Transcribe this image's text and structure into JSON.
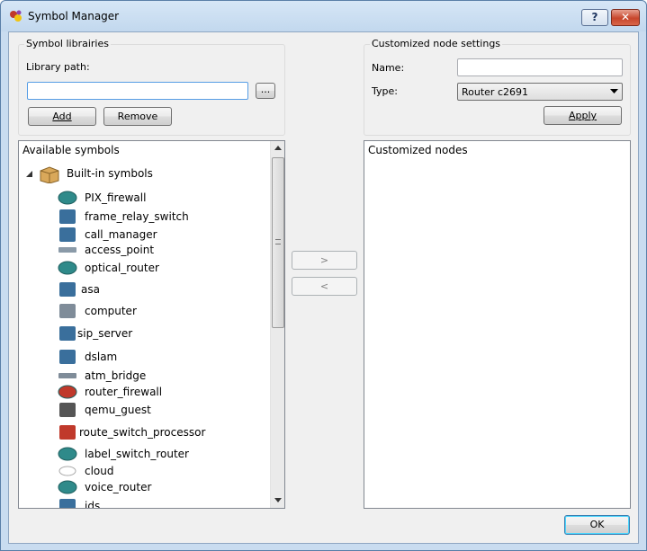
{
  "window": {
    "title": "Symbol Manager",
    "help_label": "?",
    "close_label": "✕"
  },
  "library": {
    "group_title": "Symbol librairies",
    "path_label": "Library path:",
    "path_value": "",
    "browse_label": "...",
    "add_label": "Add",
    "remove_label": "Remove"
  },
  "custom_settings": {
    "group_title": "Customized node settings",
    "name_label": "Name:",
    "name_value": "",
    "type_label": "Type:",
    "type_value": "Router c2691",
    "apply_label": "Apply"
  },
  "available": {
    "header": "Available symbols",
    "root_label": "Built-in symbols",
    "items": [
      {
        "label": "PIX_firewall",
        "icon": "firewall-icon"
      },
      {
        "label": "frame_relay_switch",
        "icon": "frame-relay-switch-icon"
      },
      {
        "label": "call_manager",
        "icon": "call-manager-icon"
      },
      {
        "label": "access_point",
        "icon": "access-point-icon"
      },
      {
        "label": "optical_router",
        "icon": "optical-router-icon"
      },
      {
        "label": "asa",
        "icon": "asa-icon"
      },
      {
        "label": "computer",
        "icon": "computer-icon"
      },
      {
        "label": "sip_server",
        "icon": "sip-server-icon"
      },
      {
        "label": "dslam",
        "icon": "dslam-icon"
      },
      {
        "label": "atm_bridge",
        "icon": "atm-bridge-icon"
      },
      {
        "label": "router_firewall",
        "icon": "router-firewall-icon"
      },
      {
        "label": "qemu_guest",
        "icon": "qemu-guest-icon"
      },
      {
        "label": "route_switch_processor",
        "icon": "route-switch-processor-icon"
      },
      {
        "label": "label_switch_router",
        "icon": "label-switch-router-icon"
      },
      {
        "label": "cloud",
        "icon": "cloud-icon"
      },
      {
        "label": "voice_router",
        "icon": "voice-router-icon"
      },
      {
        "label": "ids",
        "icon": "ids-icon"
      }
    ]
  },
  "transfer": {
    "add_label": ">",
    "remove_label": "<"
  },
  "customized": {
    "header": "Customized nodes"
  },
  "footer": {
    "ok_label": "OK"
  },
  "colors": {
    "title_bg": "#c9dcf0",
    "router_teal": "#2f8a8a",
    "close_red": "#c7462c"
  }
}
